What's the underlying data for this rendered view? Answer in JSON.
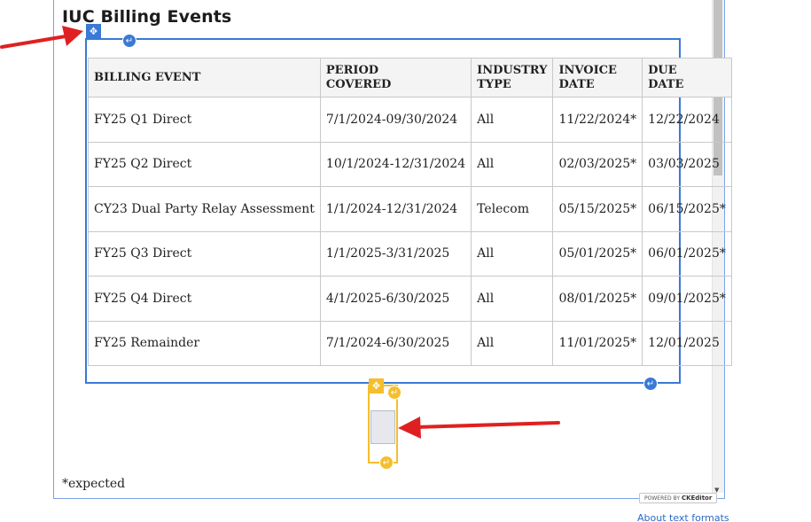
{
  "page": {
    "heading": "IUC Billing Events",
    "footnote": "*expected"
  },
  "table": {
    "headers": [
      {
        "line1": "BILLING EVENT",
        "line2": ""
      },
      {
        "line1": "PERIOD",
        "line2": "COVERED"
      },
      {
        "line1": "INDUSTRY",
        "line2": "TYPE"
      },
      {
        "line1": "INVOICE",
        "line2": "DATE"
      },
      {
        "line1": "DUE",
        "line2": "DATE"
      }
    ],
    "rows": [
      [
        "FY25 Q1 Direct",
        " 7/1/2024-09/30/2024",
        " All",
        "11/22/2024*",
        "12/22/2024"
      ],
      [
        "FY25 Q2 Direct",
        "10/1/2024-12/31/2024",
        "All",
        " 02/03/2025*",
        " 03/03/2025"
      ],
      [
        "CY23 Dual Party Relay Assessment",
        "1/1/2024-12/31/2024",
        " Telecom",
        " 05/15/2025*",
        " 06/15/2025*"
      ],
      [
        "FY25 Q3 Direct",
        "1/1/2025-3/31/2025",
        " All",
        " 05/01/2025*",
        " 06/01/2025*"
      ],
      [
        "FY25 Q4 Direct",
        "4/1/2025-6/30/2025",
        " All",
        " 08/01/2025*",
        " 09/01/2025*"
      ],
      [
        "FY25 Remainder",
        "7/1/2024-6/30/2025",
        " All",
        " 11/01/2025*",
        " 12/01/2025"
      ]
    ]
  },
  "editor": {
    "powered_by_prefix": "POWERED BY",
    "powered_by_brand": "CKEditor",
    "about_text_formats": "About text formats"
  },
  "icons": {
    "table_drag_handle": "move-icon",
    "insert_paragraph": "return-arrow-icon",
    "scroll_down": "triangle-down-icon"
  },
  "colors": {
    "selection_blue": "#3a79d6",
    "widget_yellow": "#f5be2e",
    "annotation_red": "#e02020",
    "link_blue": "#2a6cc4"
  }
}
